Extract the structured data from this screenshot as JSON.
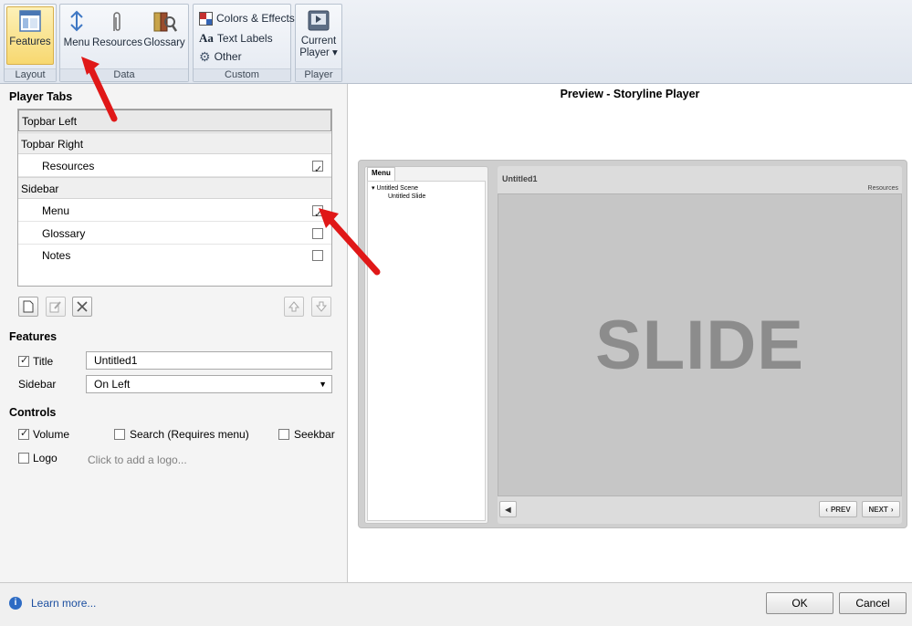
{
  "ribbon": {
    "groups": {
      "layout": "Layout",
      "data": "Data",
      "custom": "Custom",
      "player": "Player"
    },
    "buttons": {
      "features": "Features",
      "menu": "Menu",
      "resources": "Resources",
      "glossary": "Glossary",
      "colors_effects": "Colors & Effects",
      "text_labels": "Text Labels",
      "other": "Other",
      "current_player_line1": "Current",
      "current_player_line2": "Player ▾"
    }
  },
  "player_tabs": {
    "title": "Player Tabs",
    "rows": {
      "topbar_left": "Topbar Left",
      "topbar_right": "Topbar Right",
      "resources": "Resources",
      "sidebar": "Sidebar",
      "menu": "Menu",
      "glossary": "Glossary",
      "notes": "Notes"
    },
    "checked": {
      "resources": true,
      "menu": true,
      "glossary": false,
      "notes": false
    }
  },
  "features": {
    "title": "Features",
    "title_label": "Title",
    "title_value": "Untitled1",
    "sidebar_label": "Sidebar",
    "sidebar_value": "On Left"
  },
  "controls": {
    "title": "Controls",
    "volume": "Volume",
    "search": "Search (Requires menu)",
    "seekbar": "Seekbar",
    "logo": "Logo",
    "logo_hint": "Click to add a logo..."
  },
  "preview": {
    "title": "Preview - Storyline Player",
    "menu_tab": "Menu",
    "scene": "Untitled Scene",
    "slide_item": "Untitled Slide",
    "slide_title": "Untitled1",
    "resources_link": "Resources",
    "slide_text": "SLIDE",
    "prev": "PREV",
    "next": "NEXT"
  },
  "footer": {
    "learn_more": "Learn more...",
    "ok": "OK",
    "cancel": "Cancel"
  }
}
